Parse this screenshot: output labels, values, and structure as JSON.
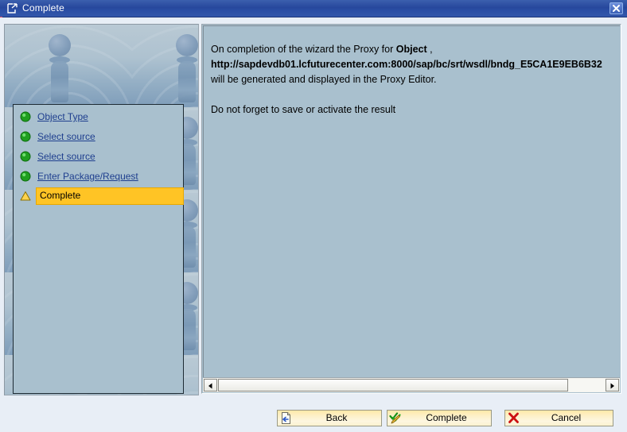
{
  "window": {
    "title": "Complete",
    "title_icon": "window-export-icon",
    "close_icon": "close-icon",
    "close_label": "Close"
  },
  "sidebar": {
    "art_icon": "decorative-pawn-ripple-image",
    "steps": [
      {
        "label": "Object Type",
        "icon": "green-status-ball-icon",
        "state": "done"
      },
      {
        "label": "Select source",
        "icon": "green-status-ball-icon",
        "state": "done"
      },
      {
        "label": "Select source",
        "icon": "green-status-ball-icon",
        "state": "done"
      },
      {
        "label": "Enter Package/Request",
        "icon": "green-status-ball-icon",
        "state": "done"
      },
      {
        "label": "Complete",
        "icon": "yellow-warning-triangle-icon",
        "state": "current"
      }
    ]
  },
  "main": {
    "line1_prefix": "On completion of the wizard the Proxy for ",
    "line1_bold": "Object",
    "line1_suffix": " ,",
    "line2_url": "http://sapdevdb01.lcfuturecenter.com:8000/sap/bc/srt/wsdl/bndg_E5CA1E9EB6B32",
    "line3": "will be generated and displayed in the Proxy Editor.",
    "line4": "Do not forget to save or activate the result",
    "scrollbar": {
      "left_arrow_icon": "scroll-left-arrow-icon",
      "right_arrow_icon": "scroll-right-arrow-icon"
    }
  },
  "footer": {
    "buttons": [
      {
        "label": "Back",
        "icon": "back-document-icon"
      },
      {
        "label": "Complete",
        "icon": "green-double-check-pencil-icon"
      },
      {
        "label": "Cancel",
        "icon": "red-x-icon"
      }
    ]
  },
  "colors": {
    "titlebar": "#2a4da4",
    "panel_bg": "#a9c0ce",
    "highlight": "#ffc425",
    "link": "#1f3f8f",
    "button_bg": "#fdf0c8",
    "footer_bg": "#e8eef6"
  }
}
